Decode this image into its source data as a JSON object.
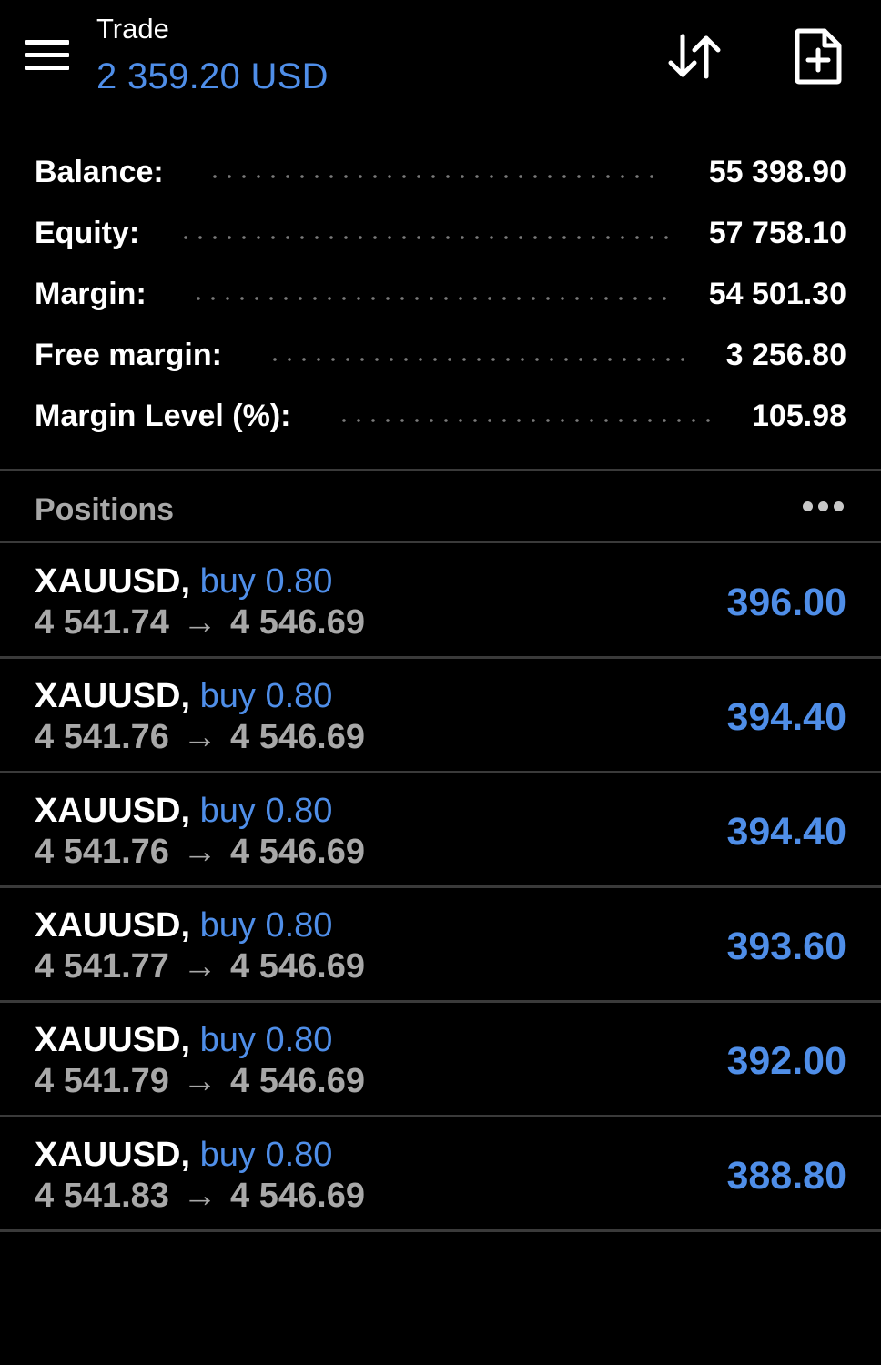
{
  "header": {
    "title": "Trade",
    "profit": "2 359.20 USD",
    "menu_icon": "hamburger-menu-icon",
    "sort_icon": "sort-arrows-icon",
    "new_order_icon": "new-order-document-plus-icon"
  },
  "summary": [
    {
      "label": "Balance:",
      "value": "55 398.90"
    },
    {
      "label": "Equity:",
      "value": "57 758.10"
    },
    {
      "label": "Margin:",
      "value": "54 501.30"
    },
    {
      "label": "Free margin:",
      "value": "3 256.80"
    },
    {
      "label": "Margin Level (%):",
      "value": "105.98"
    }
  ],
  "positions": {
    "title": "Positions",
    "more_icon": "more-horizontal-icon",
    "items": [
      {
        "symbol": "XAUUSD,",
        "type": "buy",
        "volume": "0.80",
        "open_price": "4 541.74",
        "arrow": "→",
        "current_price": "4 546.69",
        "profit": "396.00"
      },
      {
        "symbol": "XAUUSD,",
        "type": "buy",
        "volume": "0.80",
        "open_price": "4 541.76",
        "arrow": "→",
        "current_price": "4 546.69",
        "profit": "394.40"
      },
      {
        "symbol": "XAUUSD,",
        "type": "buy",
        "volume": "0.80",
        "open_price": "4 541.76",
        "arrow": "→",
        "current_price": "4 546.69",
        "profit": "394.40"
      },
      {
        "symbol": "XAUUSD,",
        "type": "buy",
        "volume": "0.80",
        "open_price": "4 541.77",
        "arrow": "→",
        "current_price": "4 546.69",
        "profit": "393.60"
      },
      {
        "symbol": "XAUUSD,",
        "type": "buy",
        "volume": "0.80",
        "open_price": "4 541.79",
        "arrow": "→",
        "current_price": "4 546.69",
        "profit": "392.00"
      },
      {
        "symbol": "XAUUSD,",
        "type": "buy",
        "volume": "0.80",
        "open_price": "4 541.83",
        "arrow": "→",
        "current_price": "4 546.69",
        "profit": "388.80"
      }
    ]
  },
  "colors": {
    "background": "#000000",
    "accent_blue": "#4f8ee8",
    "text_primary": "#ffffff",
    "text_secondary": "#a8a8a8",
    "divider": "#3a3a3a"
  }
}
